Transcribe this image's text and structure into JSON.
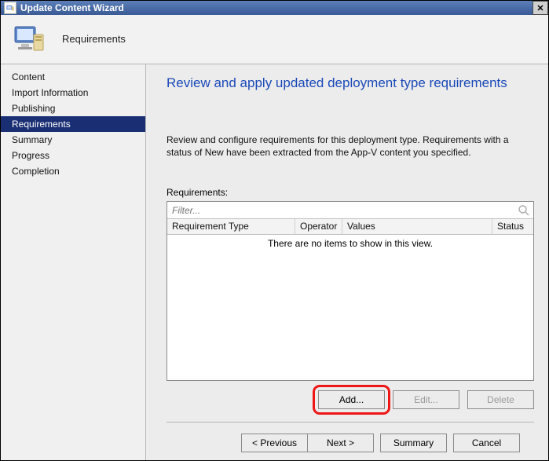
{
  "window": {
    "title": "Update Content Wizard"
  },
  "header": {
    "title": "Requirements"
  },
  "sidebar": {
    "items": [
      {
        "label": "Content",
        "selected": false
      },
      {
        "label": "Import Information",
        "selected": false
      },
      {
        "label": "Publishing",
        "selected": false
      },
      {
        "label": "Requirements",
        "selected": true
      },
      {
        "label": "Summary",
        "selected": false
      },
      {
        "label": "Progress",
        "selected": false
      },
      {
        "label": "Completion",
        "selected": false
      }
    ]
  },
  "page": {
    "heading": "Review and apply updated deployment type requirements",
    "description": "Review and configure requirements for this deployment type. Requirements with a status of New have been extracted from the App-V content you specified.",
    "requirements_label": "Requirements:",
    "filter_placeholder": "Filter...",
    "columns": {
      "req_type": "Requirement Type",
      "operator": "Operator",
      "values": "Values",
      "status": "Status"
    },
    "empty_message": "There are no items to show in this view.",
    "row_buttons": {
      "add": "Add...",
      "edit": "Edit...",
      "delete": "Delete"
    }
  },
  "footer": {
    "previous": "< Previous",
    "next": "Next >",
    "summary": "Summary",
    "cancel": "Cancel"
  }
}
